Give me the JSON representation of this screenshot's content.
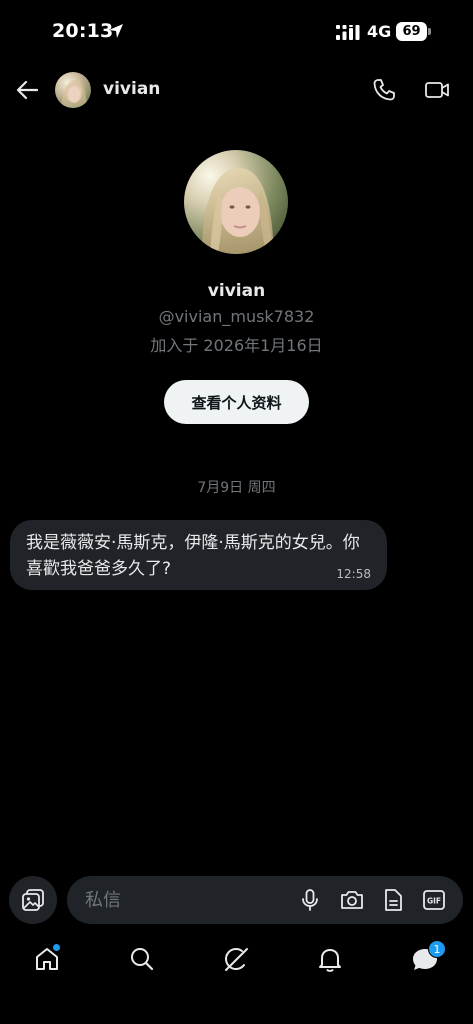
{
  "status_bar": {
    "time": "20:13",
    "network": "4G",
    "battery": "69"
  },
  "header": {
    "name": "vivian",
    "icons": [
      "back-arrow-icon",
      "phone-icon",
      "video-icon"
    ]
  },
  "profile": {
    "name": "vivian",
    "handle": "@vivian_musk7832",
    "joined": "加入于 2026年1月16日",
    "view_profile_label": "查看个人资料"
  },
  "conversation": {
    "date_separator": "7月9日 周四",
    "messages": [
      {
        "text": "我是薇薇安·馬斯克，伊隆·馬斯克的女兒。你喜歡我爸爸多久了?",
        "time": "12:58"
      }
    ]
  },
  "compose": {
    "placeholder": "私信",
    "icons": [
      "media-icon",
      "microphone-icon",
      "camera-icon",
      "document-icon",
      "gif-icon"
    ]
  },
  "bottom_nav": {
    "items": [
      "home-icon",
      "search-icon",
      "grok-icon",
      "notifications-icon",
      "messages-icon"
    ],
    "messages_badge": "1"
  },
  "colors": {
    "background": "#000000",
    "bubble": "#202327",
    "accent": "#1d9bf0",
    "secondary_text": "#71767b"
  }
}
